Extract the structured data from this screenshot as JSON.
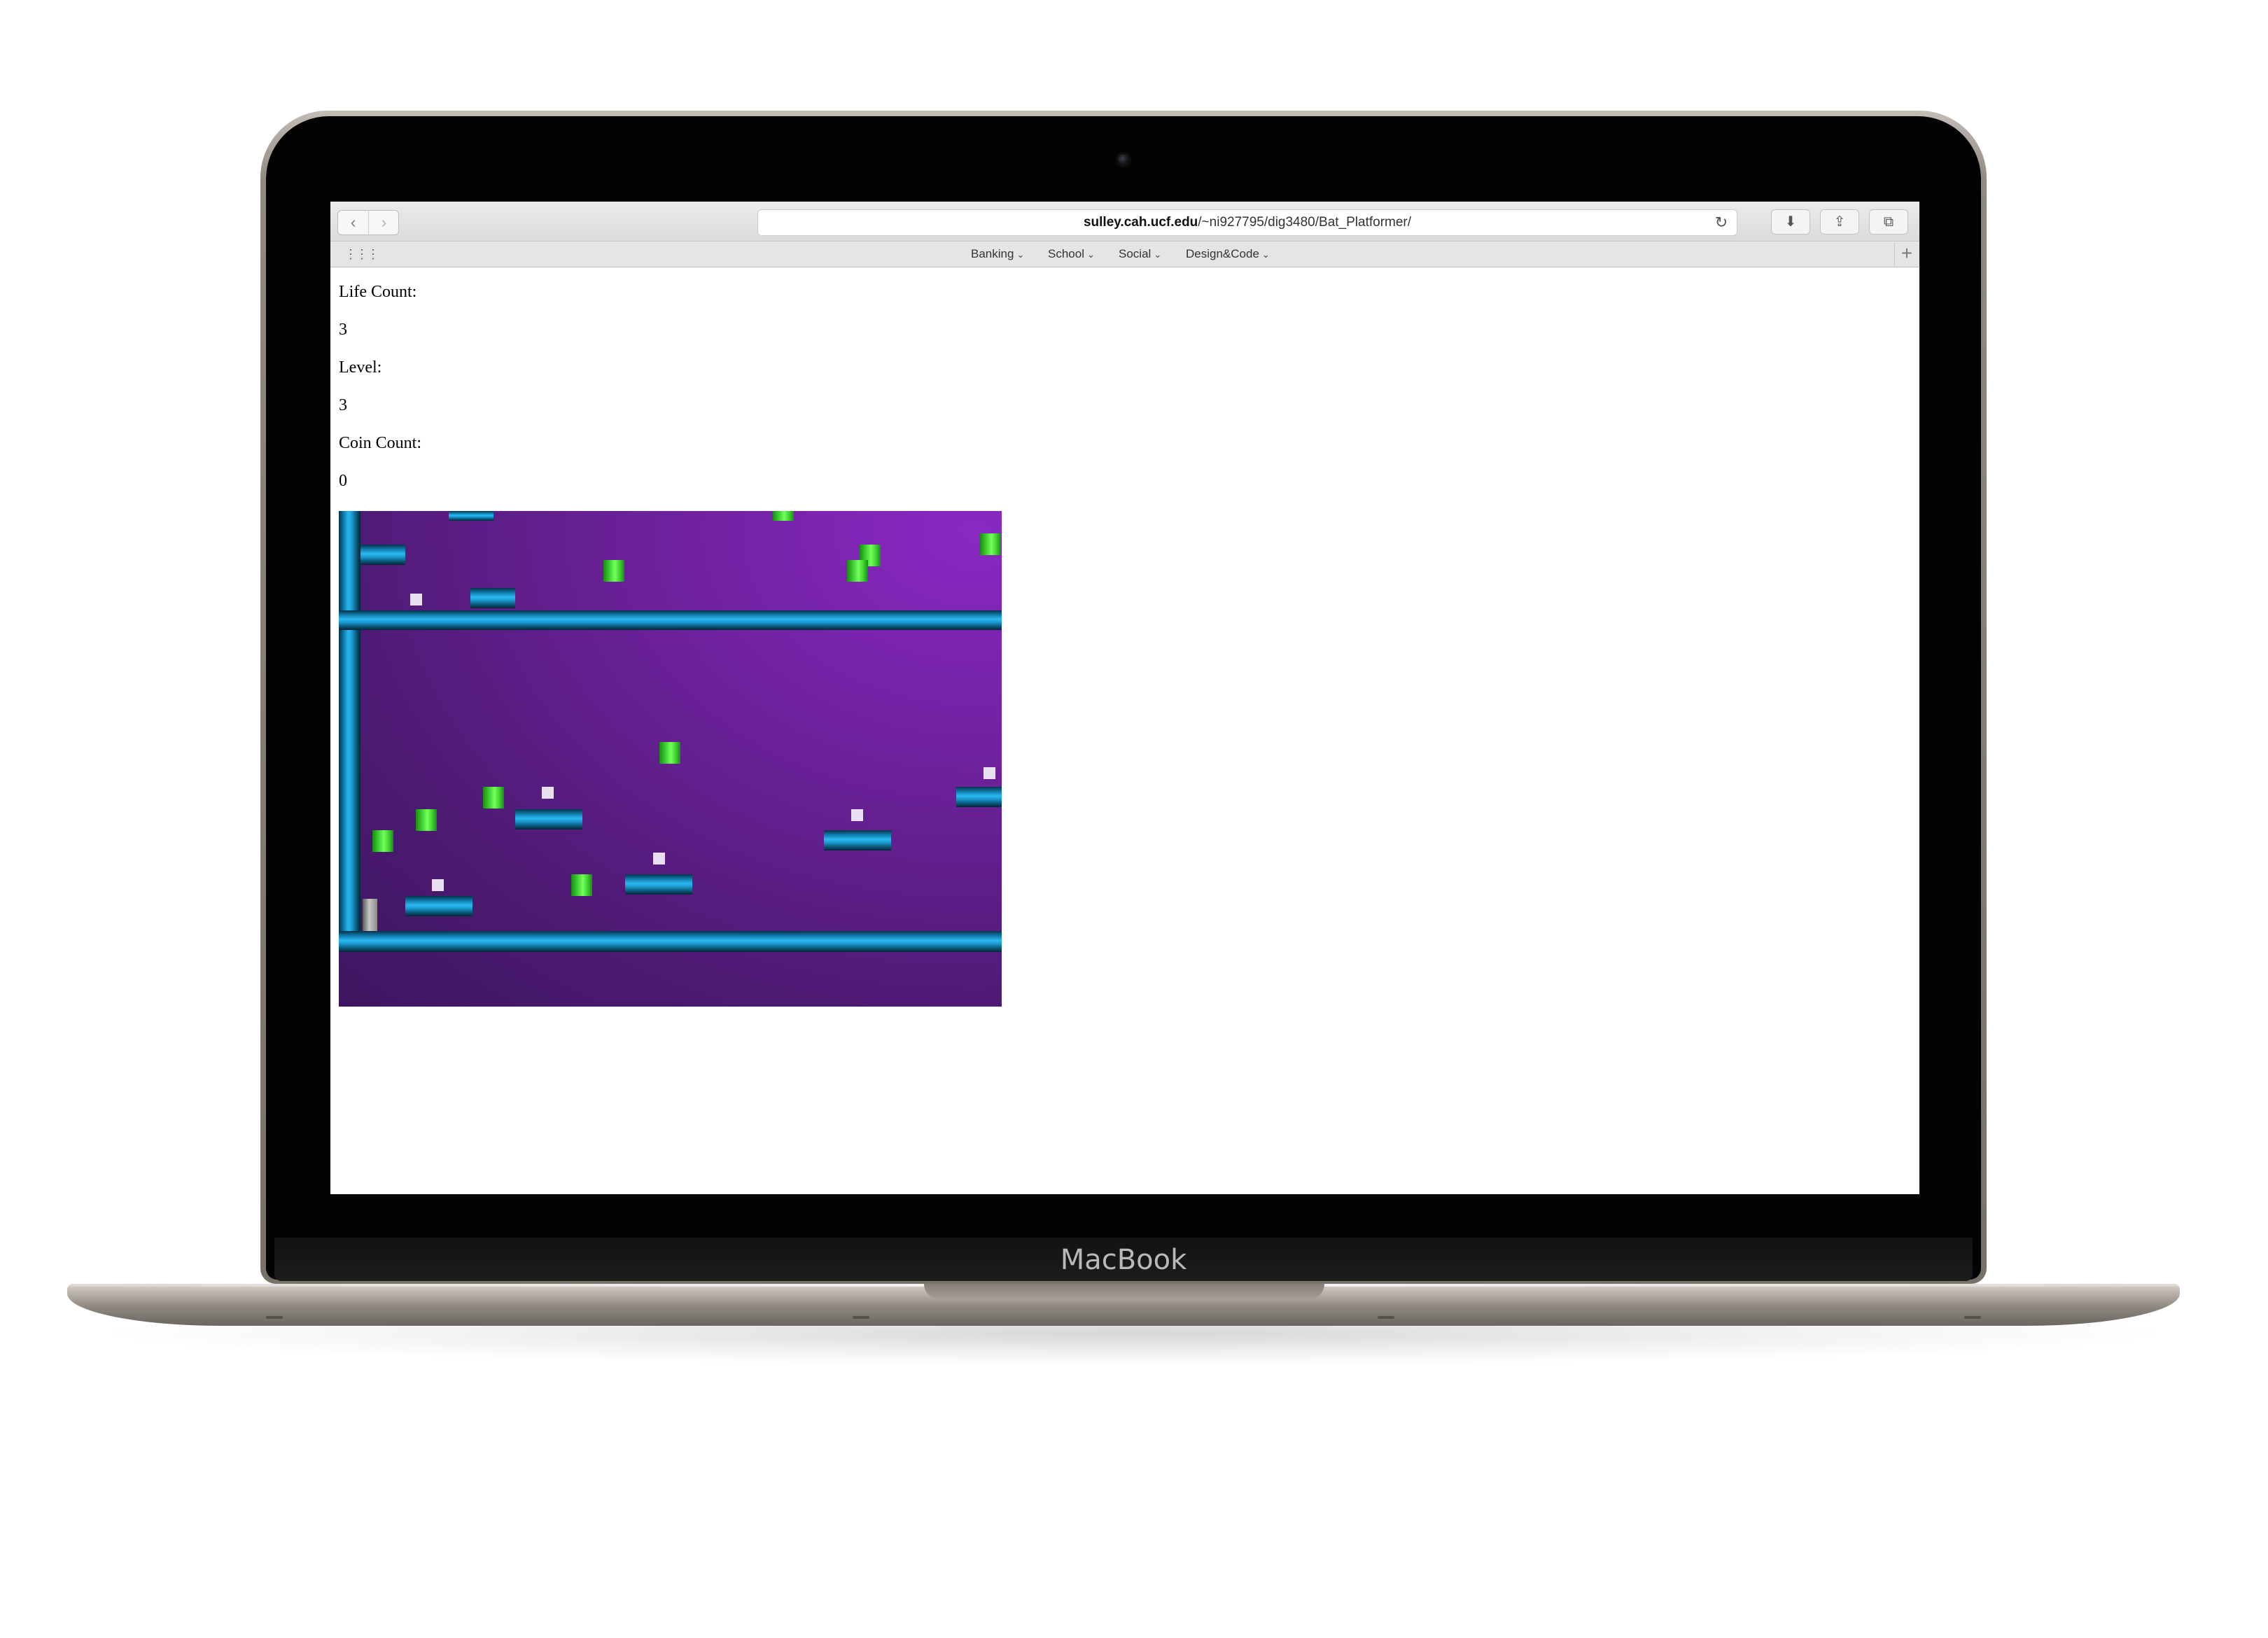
{
  "device": {
    "brand_label": "MacBook"
  },
  "browser": {
    "url_host": "sulley.cah.ucf.edu",
    "url_path": "/~ni927795/dig3480/Bat_Platformer/",
    "back_glyph": "‹",
    "forward_glyph": "›",
    "reload_glyph": "↻",
    "download_glyph": "⬇",
    "share_glyph": "⇪",
    "tabs_glyph": "⧉",
    "apps_glyph": "⋮⋮⋮",
    "new_tab_glyph": "+",
    "favorites": [
      {
        "label": "Banking"
      },
      {
        "label": "School"
      },
      {
        "label": "Social"
      },
      {
        "label": "Design&Code"
      }
    ],
    "chevron_glyph": "⌄"
  },
  "page": {
    "life_label": "Life Count:",
    "life_value": "3",
    "level_label": "Level:",
    "level_value": "3",
    "coin_label": "Coin Count:",
    "coin_value": "0"
  },
  "game": {
    "background_colors": [
      "#8a28c4",
      "#3d1660"
    ],
    "platform_color": "#2cb8f0",
    "coin_color": "#3fd132",
    "gem_color": "#e8dff0",
    "player_color": "#8a8a8a"
  }
}
